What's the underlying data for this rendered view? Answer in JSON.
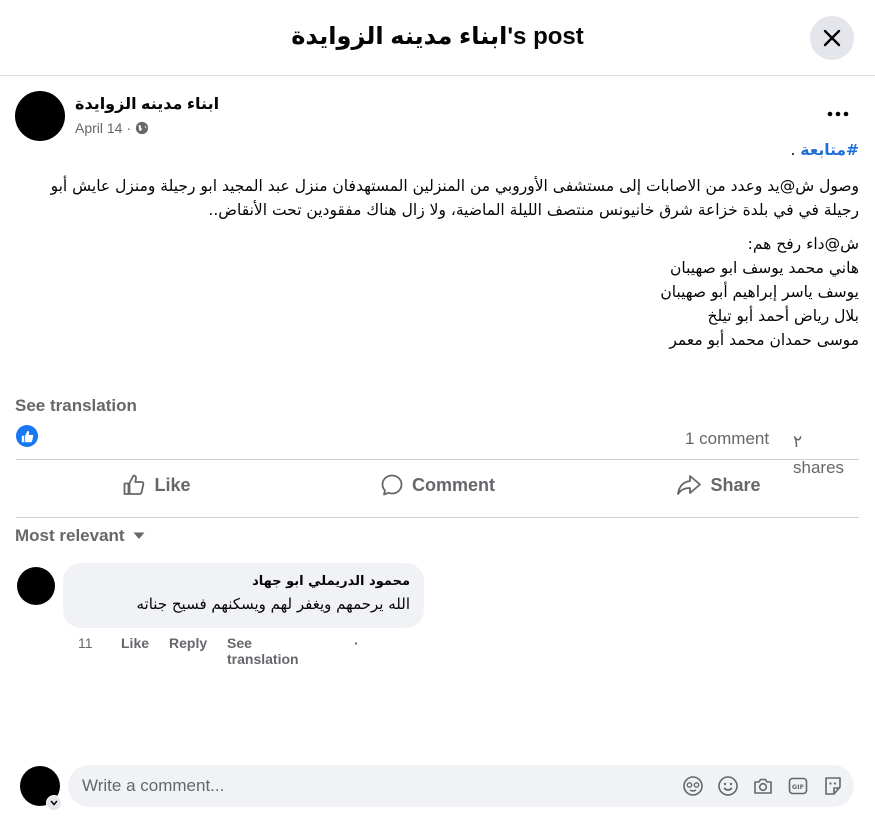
{
  "dialog": {
    "title": "ابناء مدينه الزوايدة's post",
    "close_icon": "close-icon"
  },
  "post": {
    "author": "ابناء مدينه الزوايدة",
    "date": "April 14",
    "separator": "·",
    "audience_icon": "globe-icon",
    "more_icon": "more-dots-icon",
    "hashtag": "#متابعة",
    "hashtag_suffix": " .",
    "paragraph1": "وصول ش@يد وعدد من الاصابات إلى مستشفى الأوروبي من المنزلين  المستهدفان منزل عبد المجيد ابو رجيلة ومنزل عايش أبو رجيلة في في بلدة خزاعة شرق خانيونس منتصف الليلة الماضية، ولا زال هناك مفقودين تحت الأنقاض..",
    "paragraph2": "ش@داء رفح  هم:\nهاني محمد يوسف ابو صهيبان\nيوسف ياسر إبراهيم أبو صهيبان\nبلال رياض أحمد أبو تيلخ\nموسى حمدان محمد أبو معمر",
    "see_translation": "See translation",
    "reaction_icon": "like-reaction-icon",
    "comments_count": "1 comment",
    "shares_count": "٢ shares"
  },
  "actions": {
    "like": "Like",
    "comment": "Comment",
    "share": "Share"
  },
  "comments_section": {
    "sort_label": "Most relevant",
    "comments": [
      {
        "author": "محمود الدريملي ابو جهاد",
        "text": "الله يرحمهم ويغفر لهم ويسكنهم فسيح جناته",
        "time": "11",
        "like": "Like",
        "reply": "Reply",
        "see_translation": "See translation",
        "dot": "·"
      }
    ]
  },
  "composer": {
    "placeholder": "Write a comment...",
    "icons": [
      "avatar-sticker-icon",
      "emoji-icon",
      "camera-icon",
      "gif-icon",
      "sticker-icon"
    ]
  },
  "colors": {
    "accent": "#1877f2",
    "hashtag": "#216fdb",
    "secondary_text": "#65676b",
    "bubble_bg": "#f0f2f5"
  }
}
